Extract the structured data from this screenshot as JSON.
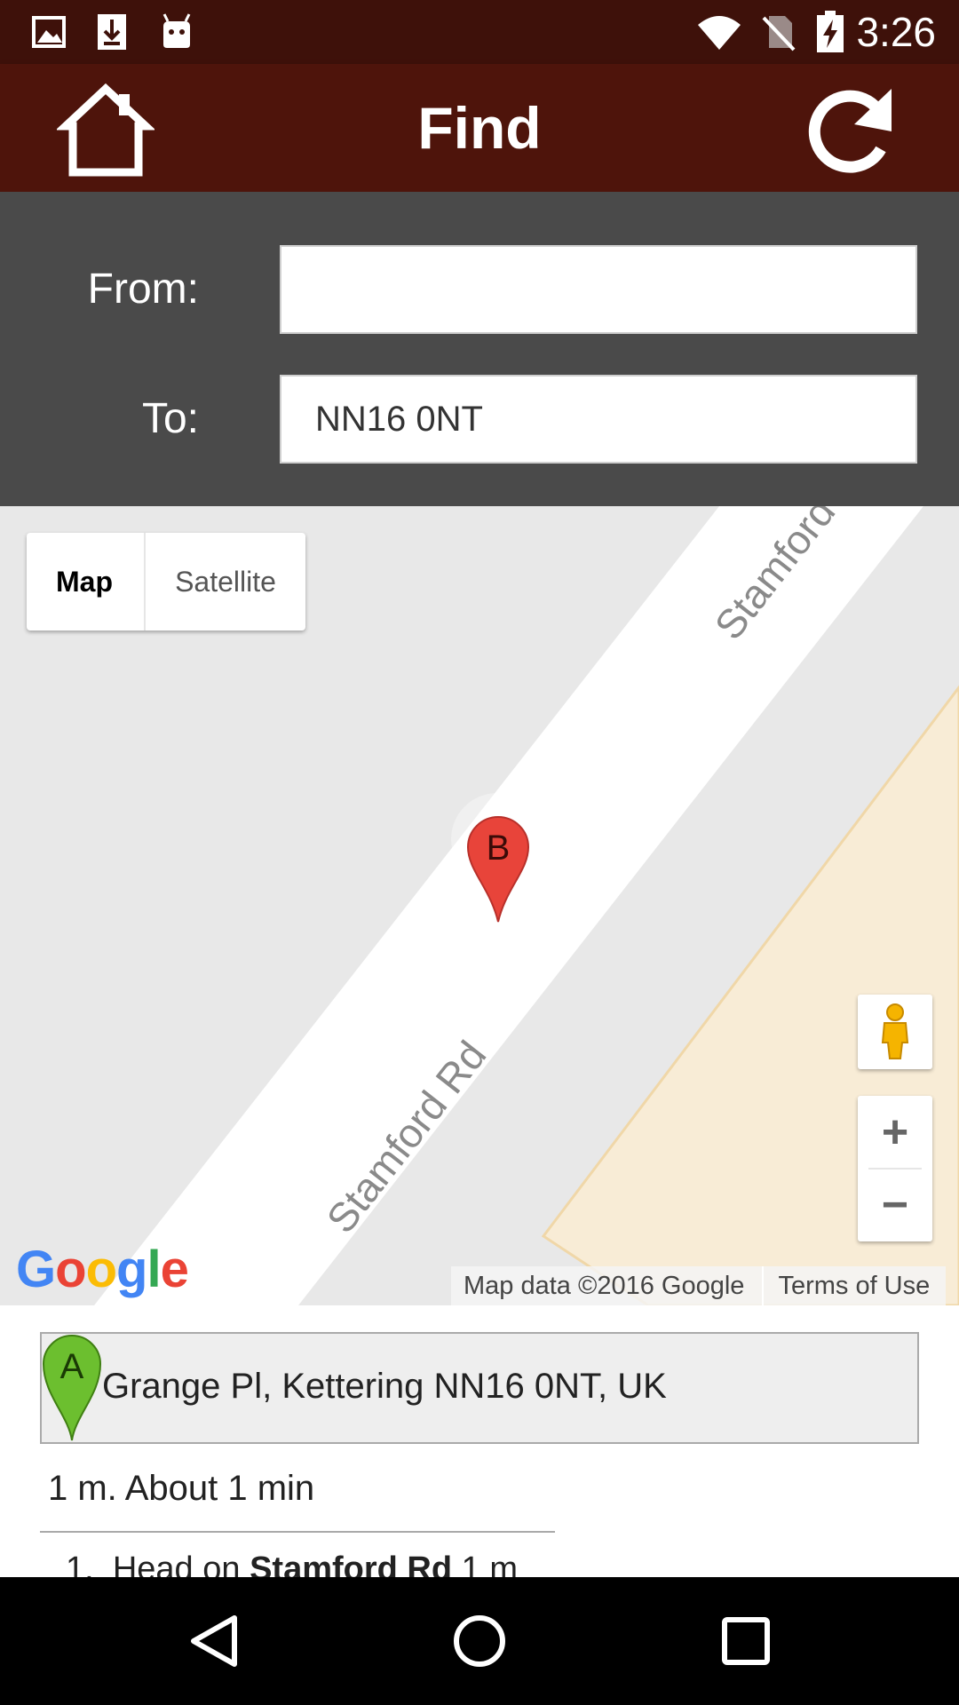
{
  "status_bar": {
    "time": "3:26",
    "left_icons": [
      "image-icon",
      "download-icon",
      "android-icon"
    ],
    "right_icons": [
      "wifi-icon",
      "no-sim-icon",
      "battery-charging-icon"
    ]
  },
  "app_bar": {
    "title": "Find",
    "home_icon": "home-icon",
    "refresh_icon": "refresh-icon",
    "color": "#4e140b"
  },
  "form": {
    "from_label": "From:",
    "from_value": "",
    "to_label": "To:",
    "to_value": "NN16 0NT"
  },
  "map": {
    "type_options": [
      "Map",
      "Satellite"
    ],
    "selected_type": "Map",
    "street_label_main": "Stamford Rd",
    "street_label_top": "Stamford",
    "marker_label": "B",
    "zoom_in": "+",
    "zoom_out": "−",
    "logo": "Google",
    "attribution": "Map data ©2016 Google",
    "terms": "Terms of Use",
    "road_color": "#ffffff",
    "land_color": "#e8e8e8",
    "area_color": "#f8ecd6"
  },
  "directions": {
    "destination_marker": "A",
    "destination": "Grange Pl, Kettering NN16 0NT, UK",
    "summary": "1 m. About 1 min",
    "steps": [
      {
        "number": "1.",
        "prefix": "Head on",
        "street": "Stamford Rd",
        "distance": "1 m"
      }
    ]
  }
}
